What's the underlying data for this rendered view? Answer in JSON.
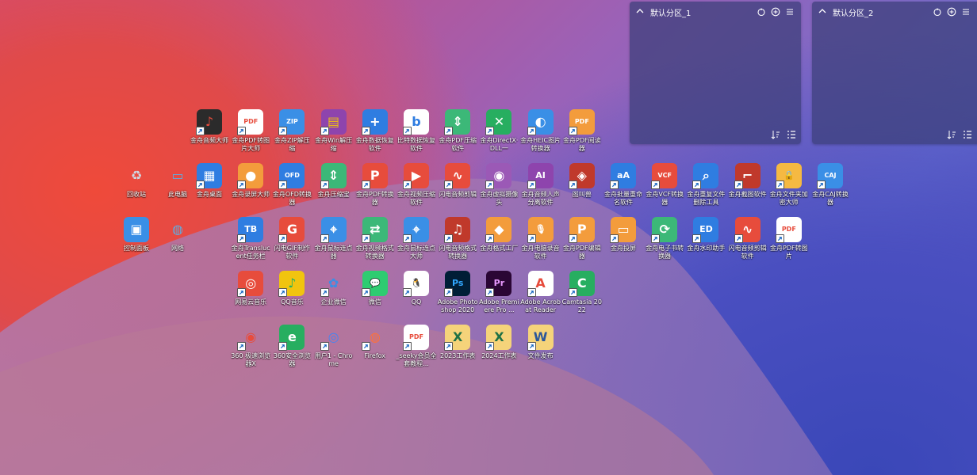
{
  "panels": [
    {
      "title": "默认分区_1"
    },
    {
      "title": "默认分区_2"
    }
  ],
  "desktop": {
    "icons": [
      {
        "label": "金舟音频大师",
        "icon": "audio-master-icon",
        "bg": "#2b2b2b",
        "fg": "#e74c3c",
        "glyph": "♪"
      },
      {
        "label": "金舟PDF转图片大师",
        "icon": "pdf-to-image-icon",
        "bg": "#ffffff",
        "fg": "#e74c3c",
        "glyph": "PDF"
      },
      {
        "label": "金舟ZIP解压缩",
        "icon": "zip-icon",
        "bg": "#3a8fe6",
        "fg": "#ffffff",
        "glyph": "ZIP"
      },
      {
        "label": "金舟Win解压缩",
        "icon": "winrar-icon",
        "bg": "#8e44ad",
        "fg": "#f1c40f",
        "glyph": "▤"
      },
      {
        "label": "金舟数据恢复软件",
        "icon": "data-recovery-icon",
        "bg": "#2f7de1",
        "fg": "#ffffff",
        "glyph": "+"
      },
      {
        "label": "比特数据恢复软件",
        "icon": "bit-recovery-icon",
        "bg": "#ffffff",
        "fg": "#2f7de1",
        "glyph": "b"
      },
      {
        "label": "金舟PDF压缩软件",
        "icon": "pdf-compress-icon",
        "bg": "#3cb878",
        "fg": "#ffffff",
        "glyph": "⇕"
      },
      {
        "label": "金舟DirectX·DLL一",
        "icon": "directx-icon",
        "bg": "#27ae60",
        "fg": "#ffffff",
        "glyph": "✕"
      },
      {
        "label": "金舟HEIC图片转换器",
        "icon": "heic-icon",
        "bg": "#3a8fe6",
        "fg": "#ffffff",
        "glyph": "◐"
      },
      {
        "label": "金舟PDF阅读器",
        "icon": "pdf-reader-icon",
        "bg": "#f39c3c",
        "fg": "#ffffff",
        "glyph": "PDF"
      },
      {
        "label": "回收站",
        "icon": "recycle-bin-icon",
        "bg": "transparent",
        "fg": "#cfd8e3",
        "glyph": "♻"
      },
      {
        "label": "此电脑",
        "icon": "this-pc-icon",
        "bg": "transparent",
        "fg": "#5dade2",
        "glyph": "▭"
      },
      {
        "label": "金舟桌面",
        "icon": "desktop-app-icon",
        "bg": "#2f7de1",
        "fg": "#ffffff",
        "glyph": "▦"
      },
      {
        "label": "金舟录屏大师",
        "icon": "screen-record-icon",
        "bg": "#f39c3c",
        "fg": "#ffffff",
        "glyph": "●"
      },
      {
        "label": "金舟OFD转换器",
        "icon": "ofd-icon",
        "bg": "#2f7de1",
        "fg": "#ffffff",
        "glyph": "OFD"
      },
      {
        "label": "金舟压缩宝",
        "icon": "compress-icon",
        "bg": "#3cb878",
        "fg": "#ffffff",
        "glyph": "⇕"
      },
      {
        "label": "金舟PDF转换器",
        "icon": "pdf-converter-icon",
        "bg": "#e74c3c",
        "fg": "#ffffff",
        "glyph": "P"
      },
      {
        "label": "金舟视频压缩软件",
        "icon": "video-compress-icon",
        "bg": "#e74c3c",
        "fg": "#ffffff",
        "glyph": "▶"
      },
      {
        "label": "闪电音频剪辑",
        "icon": "audio-edit-icon",
        "bg": "#e74c3c",
        "fg": "#ffffff",
        "glyph": "∿"
      },
      {
        "label": "金舟虚拟摄像头",
        "icon": "virtual-camera-icon",
        "bg": "#9b59b6",
        "fg": "#ffffff",
        "glyph": "◉"
      },
      {
        "label": "金舟音频人声分离软件",
        "icon": "vocal-split-icon",
        "bg": "#8e44ad",
        "fg": "#ffffff",
        "glyph": "AI"
      },
      {
        "label": "图叫兽",
        "icon": "tujiaoshou-icon",
        "bg": "#c0392b",
        "fg": "#ffffff",
        "glyph": "◈"
      },
      {
        "label": "金舟批量重命名软件",
        "icon": "batch-rename-icon",
        "bg": "#2f7de1",
        "fg": "#ffffff",
        "glyph": "aA"
      },
      {
        "label": "金舟VCF转换器",
        "icon": "vcf-icon",
        "bg": "#e74c3c",
        "fg": "#ffffff",
        "glyph": "VCF"
      },
      {
        "label": "金舟重复文件删除工具",
        "icon": "duplicate-file-icon",
        "bg": "#2f7de1",
        "fg": "#ffffff",
        "glyph": "⌕"
      },
      {
        "label": "金舟截图软件",
        "icon": "screenshot-icon",
        "bg": "#c0392b",
        "fg": "#ffffff",
        "glyph": "⌐"
      },
      {
        "label": "金舟文件夹加密大师",
        "icon": "folder-lock-icon",
        "bg": "#f5b942",
        "fg": "#ffffff",
        "glyph": "🔒"
      },
      {
        "label": "金舟CAJ转换器",
        "icon": "caj-icon",
        "bg": "#3a8fe6",
        "fg": "#ffffff",
        "glyph": "CAJ"
      },
      {
        "label": "控制面板",
        "icon": "control-panel-icon",
        "bg": "#3a8fe6",
        "fg": "#ffffff",
        "glyph": "▣"
      },
      {
        "label": "网络",
        "icon": "network-icon",
        "bg": "transparent",
        "fg": "#5dade2",
        "glyph": "◍"
      },
      {
        "label": "金舟Translucent任务栏",
        "icon": "translucent-taskbar-icon",
        "bg": "#2f7de1",
        "fg": "#ffffff",
        "glyph": "TB"
      },
      {
        "label": "闪电GIF制作软件",
        "icon": "gif-maker-icon",
        "bg": "#e74c3c",
        "fg": "#ffffff",
        "glyph": "G"
      },
      {
        "label": "金舟鼠标连点器",
        "icon": "mouse-clicker-icon",
        "bg": "#3a8fe6",
        "fg": "#ffffff",
        "glyph": "⌖"
      },
      {
        "label": "金舟视频格式转换器",
        "icon": "video-format-icon",
        "bg": "#3cb878",
        "fg": "#ffffff",
        "glyph": "⇄"
      },
      {
        "label": "金舟鼠标连点大师",
        "icon": "mouse-master-icon",
        "bg": "#3a8fe6",
        "fg": "#ffffff",
        "glyph": "⌖"
      },
      {
        "label": "闪电音频格式转换器",
        "icon": "audio-format-icon",
        "bg": "#c0392b",
        "fg": "#ffffff",
        "glyph": "♫"
      },
      {
        "label": "金舟格式工厂",
        "icon": "format-factory-icon",
        "bg": "#f39c3c",
        "fg": "#ffffff",
        "glyph": "◆"
      },
      {
        "label": "金舟电脑录音软件",
        "icon": "recorder-icon",
        "bg": "#f39c3c",
        "fg": "#ffffff",
        "glyph": "🎙"
      },
      {
        "label": "金舟PDF编辑器",
        "icon": "pdf-editor-icon",
        "bg": "#f39c3c",
        "fg": "#ffffff",
        "glyph": "P"
      },
      {
        "label": "金舟投屏",
        "icon": "cast-screen-icon",
        "bg": "#f39c3c",
        "fg": "#ffffff",
        "glyph": "▭"
      },
      {
        "label": "金舟电子书转换器",
        "icon": "ebook-icon",
        "bg": "#3cb878",
        "fg": "#ffffff",
        "glyph": "⟳"
      },
      {
        "label": "金舟水印助手",
        "icon": "watermark-icon",
        "bg": "#2f7de1",
        "fg": "#ffffff",
        "glyph": "ED"
      },
      {
        "label": "闪电音频剪辑软件",
        "icon": "audio-edit-2-icon",
        "bg": "#e74c3c",
        "fg": "#ffffff",
        "glyph": "∿"
      },
      {
        "label": "金舟PDF转图片",
        "icon": "pdf-image-icon",
        "bg": "#ffffff",
        "fg": "#e74c3c",
        "glyph": "PDF"
      },
      {
        "label": "网易云音乐",
        "icon": "netease-music-icon",
        "bg": "#e74c3c",
        "fg": "#ffffff",
        "glyph": "◎"
      },
      {
        "label": "QQ音乐",
        "icon": "qq-music-icon",
        "bg": "#f1c40f",
        "fg": "#27ae60",
        "glyph": "♪"
      },
      {
        "label": "企业微信",
        "icon": "wecom-icon",
        "bg": "transparent",
        "fg": "#3a8fe6",
        "glyph": "✿"
      },
      {
        "label": "微信",
        "icon": "wechat-icon",
        "bg": "#2ecc71",
        "fg": "#ffffff",
        "glyph": "💬"
      },
      {
        "label": "QQ",
        "icon": "qq-icon",
        "bg": "#ffffff",
        "fg": "#111111",
        "glyph": "🐧"
      },
      {
        "label": "Adobe Photoshop 2020",
        "icon": "photoshop-icon",
        "bg": "#001e36",
        "fg": "#31a8ff",
        "glyph": "Ps"
      },
      {
        "label": "Adobe Premiere Pro ...",
        "icon": "premiere-icon",
        "bg": "#2a0634",
        "fg": "#e99bff",
        "glyph": "Pr"
      },
      {
        "label": "Adobe Acrobat Reader",
        "icon": "acrobat-icon",
        "bg": "#ffffff",
        "fg": "#e74c3c",
        "glyph": "A"
      },
      {
        "label": "Camtasia 2022",
        "icon": "camtasia-icon",
        "bg": "#27ae60",
        "fg": "#ffffff",
        "glyph": "C"
      },
      {
        "label": "360 极速浏览器X",
        "icon": "360-browser-icon",
        "bg": "transparent",
        "fg": "#e74c3c",
        "glyph": "◉"
      },
      {
        "label": "360安全浏览器",
        "icon": "360-safe-browser-icon",
        "bg": "#27ae60",
        "fg": "#ffffff",
        "glyph": "e"
      },
      {
        "label": "用户1 - Chrome",
        "icon": "chrome-icon",
        "bg": "transparent",
        "fg": "#4285f4",
        "glyph": "◎"
      },
      {
        "label": "Firefox",
        "icon": "firefox-icon",
        "bg": "transparent",
        "fg": "#ff7139",
        "glyph": "◍"
      },
      {
        "label": "_seeky会员全套教程...",
        "icon": "pdf-file-icon",
        "bg": "#ffffff",
        "fg": "#e74c3c",
        "glyph": "PDF"
      },
      {
        "label": "2023工作表",
        "icon": "excel-file-icon",
        "bg": "#f5d37a",
        "fg": "#1e7145",
        "glyph": "X"
      },
      {
        "label": "2024工作表",
        "icon": "excel-file-2-icon",
        "bg": "#f5d37a",
        "fg": "#1e7145",
        "glyph": "X"
      },
      {
        "label": "文件发布",
        "icon": "word-file-icon",
        "bg": "#f5d37a",
        "fg": "#2b579a",
        "glyph": "W"
      }
    ]
  }
}
